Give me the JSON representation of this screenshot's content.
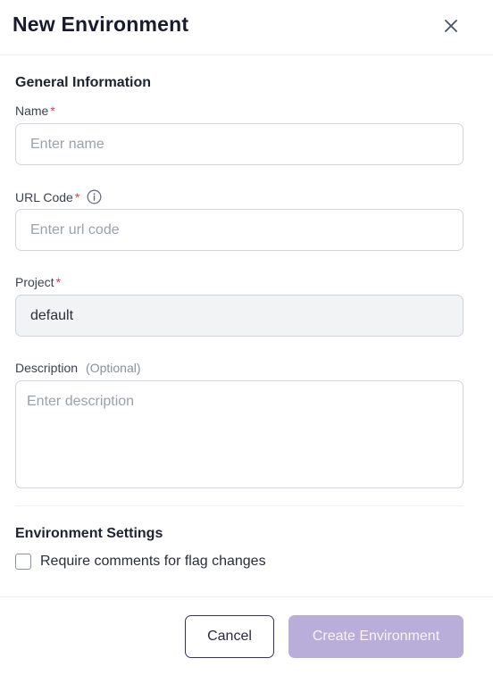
{
  "dialog": {
    "title": "New Environment"
  },
  "general": {
    "section_title": "General Information",
    "name": {
      "label": "Name",
      "placeholder": "Enter name",
      "value": ""
    },
    "url_code": {
      "label": "URL Code",
      "placeholder": "Enter url code",
      "value": ""
    },
    "project": {
      "label": "Project",
      "value": "default"
    },
    "description": {
      "label": "Description",
      "optional": "(Optional)",
      "placeholder": "Enter description",
      "value": ""
    }
  },
  "settings": {
    "section_title": "Environment Settings",
    "require_comments": {
      "label": "Require comments for flag changes",
      "checked": false
    }
  },
  "footer": {
    "cancel_label": "Cancel",
    "create_label": "Create Environment"
  },
  "required_marker": "*",
  "colors": {
    "required": "#e2384d",
    "primary_disabled": "#b9aed9",
    "primary_outline": "#3b2f66"
  }
}
